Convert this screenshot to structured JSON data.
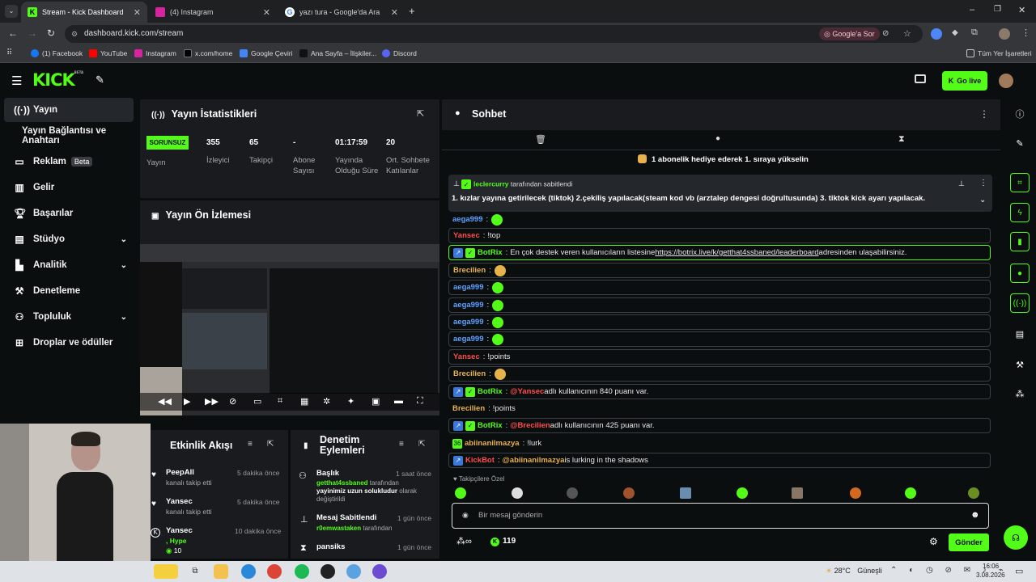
{
  "browser": {
    "tabs": [
      {
        "title": "Stream - Kick Dashboard",
        "icon": "kick-icon"
      },
      {
        "title": "(4) Instagram",
        "icon": "instagram-icon"
      },
      {
        "title": "yazı tura - Google'da Ara",
        "icon": "google-icon"
      }
    ],
    "url": "dashboard.kick.com/stream",
    "google_sor": "Google'a Sor",
    "bookmarks": [
      "(1) Facebook",
      "YouTube",
      "Instagram",
      "x.com/home",
      "Google Çeviri",
      "Ana Sayfa – İlişkiler...",
      "Discord"
    ],
    "all_bookmarks": "Tüm Yer İşaretleri"
  },
  "header": {
    "logo": "KICK",
    "logo_sup": "BETA",
    "go_live": "Go live"
  },
  "sidebar": {
    "items": [
      {
        "label": "Yayın",
        "icon": "broadcast-icon"
      },
      {
        "label": "Yayın Bağlantısı ve Anahtarı",
        "icon": ""
      },
      {
        "label": "Reklam",
        "badge": "Beta",
        "icon": "monitor-icon"
      },
      {
        "label": "Gelir",
        "icon": "chart-icon"
      },
      {
        "label": "Başarılar",
        "icon": "trophy-icon"
      },
      {
        "label": "Stüdyo",
        "icon": "studio-icon"
      },
      {
        "label": "Analitik",
        "icon": "analytics-icon"
      },
      {
        "label": "Denetleme",
        "icon": "hammer-icon"
      },
      {
        "label": "Topluluk",
        "icon": "community-icon"
      },
      {
        "label": "Droplar ve ödüller",
        "icon": "gift-icon"
      }
    ]
  },
  "stats": {
    "title": "Yayın İstatistikleri",
    "status": "SORUNSUZ",
    "status_label": "Yayın",
    "items": [
      {
        "value": "355",
        "label": "İzleyici"
      },
      {
        "value": "65",
        "label": "Takipçi"
      },
      {
        "value": "-",
        "label": "Abone Sayısı"
      },
      {
        "value": "01:17:59",
        "label": "Yayında Olduğu Süre"
      },
      {
        "value": "20",
        "label": "Ort. Sohbete Katılanlar"
      }
    ]
  },
  "preview": {
    "title": "Yayın Ön İzlemesi"
  },
  "activity": {
    "title": "Etkinlik Akışı",
    "items": [
      {
        "name": "PeepAll",
        "sub": "kanalı takip etti",
        "time": "5 dakika önce"
      },
      {
        "name": "Yansec",
        "sub": "kanalı takip etti",
        "time": "5 dakika önce"
      },
      {
        "name": "Yansec",
        "sub": ", Hype",
        "extra": "10",
        "time": "10 dakika önce"
      }
    ]
  },
  "moderation": {
    "title": "Denetim Eylemleri",
    "items": [
      {
        "title": "Başlık",
        "actor": "getthat4ssbaned",
        "desc_a": " tarafından ",
        "desc_b": "yayinimiz uzun solukludur",
        "desc_c": " olarak değiştirildi",
        "time": "1 saat önce"
      },
      {
        "title": "Mesaj Sabitlendi",
        "actor": "r0emwastaken",
        "desc_a": " tarafından",
        "time": "1 gün önce"
      },
      {
        "title": "pansiks",
        "time": "1 gün önce"
      }
    ]
  },
  "chat": {
    "title": "Sohbet",
    "gift_banner": "1 abonelik hediye ederek 1. sıraya yükselin",
    "pinned": {
      "user": "leclercurry",
      "by": "tarafından sabitlendi",
      "text": "1. kızlar yayına getirilecek (tiktok) 2.çekiliş yapılacak(steam kod vb (arztalep dengesi doğrultusunda) 3. tiktok kick ayarı yapılacak."
    },
    "messages": [
      {
        "user": "aega999",
        "color": "#5ea0ff",
        "text": "",
        "emote": "green"
      },
      {
        "user": "Yansec",
        "color": "#ff4d4d",
        "text": "!top"
      },
      {
        "user": "BotRix",
        "color": "#53fc18",
        "bot": true,
        "text": "En çok destek veren kullanıcıların listesine ",
        "link": "https://botrix.live/k/getthat4ssbaned/leaderboard",
        "text2": " adresinden ulaşabilirsiniz.",
        "highlight": true
      },
      {
        "user": "Brecilien",
        "color": "#e8b24a",
        "text": "",
        "emote": "yellow"
      },
      {
        "user": "aega999",
        "color": "#5ea0ff",
        "text": "",
        "emote": "green"
      },
      {
        "user": "aega999",
        "color": "#5ea0ff",
        "text": "",
        "emote": "green"
      },
      {
        "user": "aega999",
        "color": "#5ea0ff",
        "text": "",
        "emote": "green"
      },
      {
        "user": "aega999",
        "color": "#5ea0ff",
        "text": "",
        "emote": "green"
      },
      {
        "user": "Yansec",
        "color": "#ff4d4d",
        "text": "!points"
      },
      {
        "user": "Brecilien",
        "color": "#e8b24a",
        "text": "",
        "emote": "yellow"
      },
      {
        "user": "BotRix",
        "color": "#53fc18",
        "bot": true,
        "mention": "@Yansec",
        "text": " adlı kullanıcının 840 puanı var."
      },
      {
        "user": "Brecilien",
        "color": "#e8b24a",
        "text": "!points"
      },
      {
        "user": "BotRix",
        "color": "#53fc18",
        "bot": true,
        "mention": "@Brecilien",
        "text": " adlı kullanıcının 425 puanı var."
      },
      {
        "user": "abiinanilmazya",
        "color": "#e8b24a",
        "text": "!lurk"
      },
      {
        "user": "KickBot",
        "color": "#ff4d4d",
        "bot": true,
        "mention": "@abiinanilmazya",
        "text": " is lurking in the shadows"
      }
    ],
    "followers_label": "Takipçilere Özel",
    "input_placeholder": "Bir mesaj gönderin",
    "points": "119",
    "send": "Gönder"
  },
  "taskbar": {
    "weather": "28°C",
    "weather_text": "Güneşli",
    "time": "16:06",
    "date": "3.08.2026"
  },
  "colors": {
    "accent": "#53fc18",
    "bg": "#0b0e0f",
    "panel": "#191b1f"
  }
}
